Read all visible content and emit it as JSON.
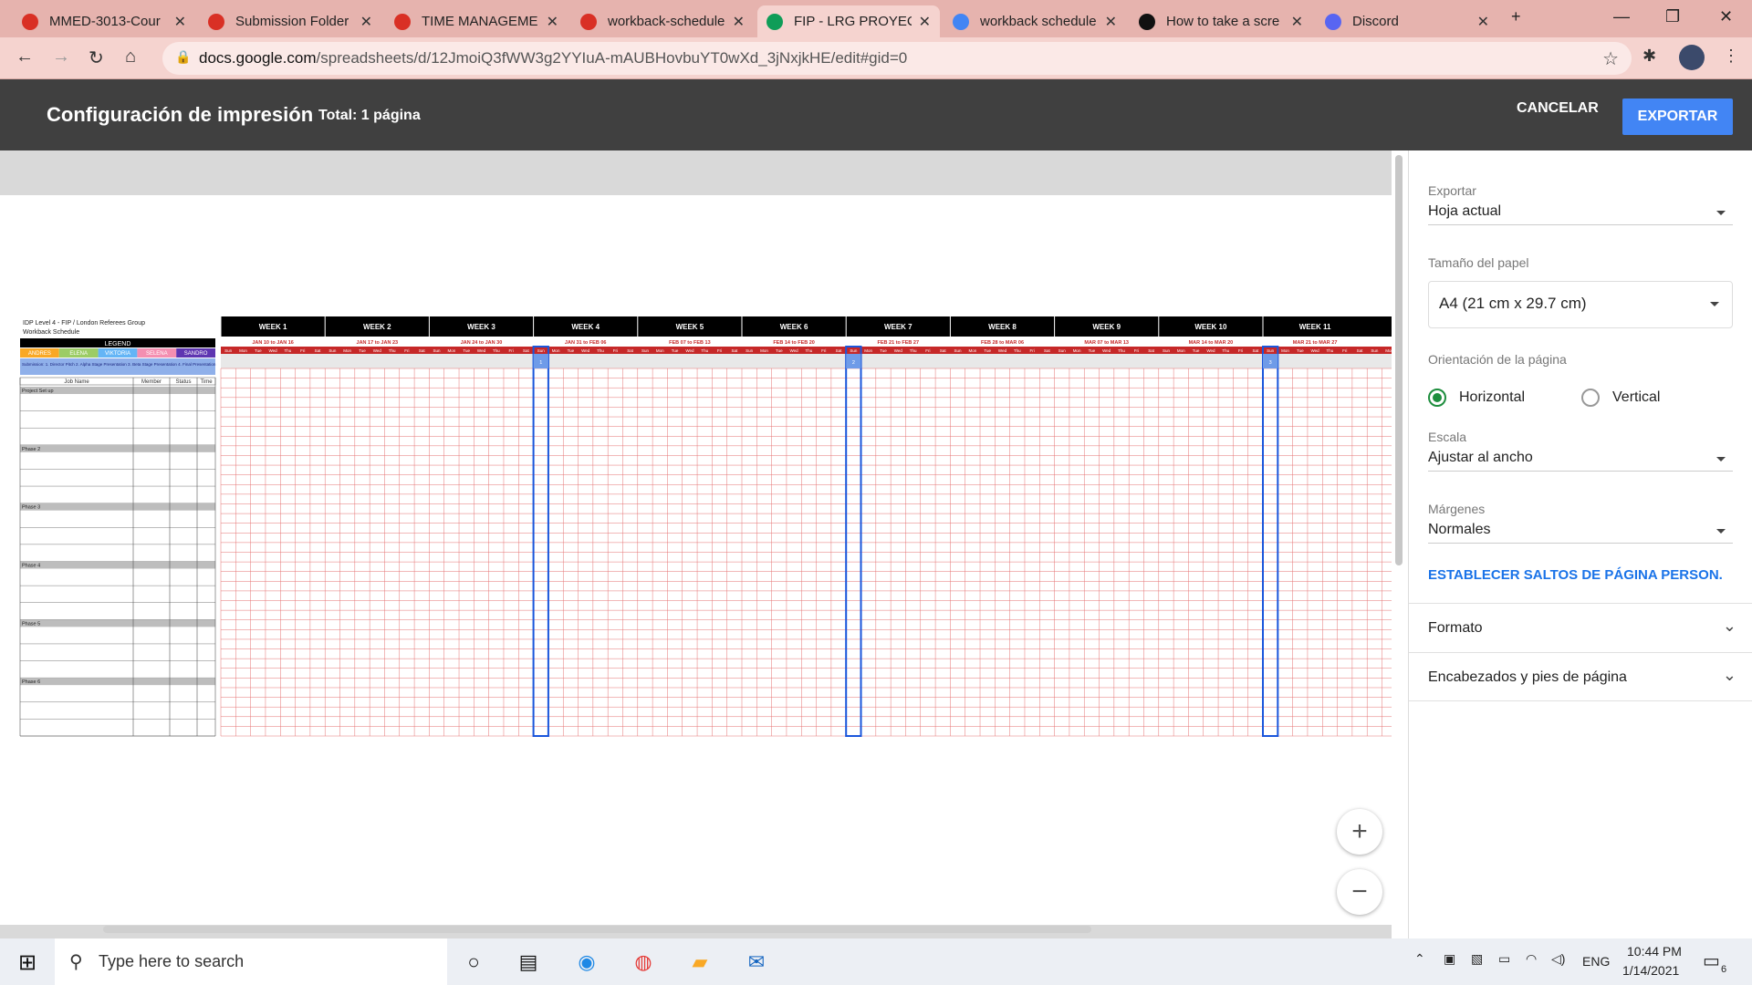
{
  "browser": {
    "tabs": [
      {
        "title": "MMED-3013-Cour",
        "favicon": "owl-icon",
        "color": "#d93025"
      },
      {
        "title": "Submission Folder",
        "favicon": "owl-icon",
        "color": "#d93025"
      },
      {
        "title": "TIME MANAGEME",
        "favicon": "owl-icon",
        "color": "#d93025"
      },
      {
        "title": "workback-schedule",
        "favicon": "owl-icon",
        "color": "#d93025"
      },
      {
        "title": "FIP - LRG PROYECT",
        "favicon": "sheets-icon",
        "color": "#0f9d58",
        "active": true
      },
      {
        "title": "workback schedule",
        "favicon": "google-icon",
        "color": "#4285f4"
      },
      {
        "title": "How to take a scre",
        "favicon": "g-icon",
        "color": "#111111"
      },
      {
        "title": "Discord",
        "favicon": "discord-icon",
        "color": "#5865f2"
      }
    ],
    "new_tab": "+",
    "url_host": "docs.google.com",
    "url_path": "/spreadsheets/d/12JmoiQ3fWW3g2YYIuA-mAUBHovbuYT0wXd_3jNxjkHE/edit#gid=0"
  },
  "header": {
    "title": "Configuración de impresión",
    "total": "Total: 1 página",
    "cancel_label": "CANCELAR",
    "export_label": "EXPORTAR",
    "accent": "#4285f4"
  },
  "sheet": {
    "title_line1": "IDP Level 4 - FIP / London Referees Group",
    "title_line2": "Workback Schedule",
    "legend_label": "LEGEND",
    "members": [
      {
        "name": "ANDRES",
        "color": "#f9a825"
      },
      {
        "name": "ELENA",
        "color": "#9ccc65"
      },
      {
        "name": "VIKTORIA",
        "color": "#64b5f6"
      },
      {
        "name": "SELENA",
        "color": "#f48fb1"
      },
      {
        "name": "SANDRO",
        "color": "#5e35b1"
      }
    ],
    "submission_note": "Submission: 1. Director Pitch 2. Alpha Stage Presentation 3. Beta Stage Presentation 4. Final Presentation",
    "columns": [
      "Job Name",
      "Member",
      "Status",
      "Time"
    ],
    "phases": [
      "Project Set up",
      "Phase 2",
      "Phase 3",
      "Phase 4",
      "Phase 5",
      "Phase 6"
    ],
    "weeks": [
      {
        "label": "WEEK 1",
        "range": "JAN 10 to JAN 16"
      },
      {
        "label": "WEEK 2",
        "range": "JAN 17 to JAN 23"
      },
      {
        "label": "WEEK 3",
        "range": "JAN 24 to JAN 30"
      },
      {
        "label": "WEEK 4",
        "range": "JAN 31 to FEB 06"
      },
      {
        "label": "WEEK 5",
        "range": "FEB 07 to FEB 13"
      },
      {
        "label": "WEEK 6",
        "range": "FEB 14 to FEB 20"
      },
      {
        "label": "WEEK 7",
        "range": "FEB 21 to FEB 27"
      },
      {
        "label": "WEEK 8",
        "range": "FEB 28 to MAR 06"
      },
      {
        "label": "WEEK 9",
        "range": "MAR 07 to MAR 13"
      },
      {
        "label": "WEEK 10",
        "range": "MAR 14 to MAR 20"
      },
      {
        "label": "WEEK 11",
        "range": "MAR 21 to MAR 27"
      }
    ],
    "day_labels": [
      "Sun",
      "Mon",
      "Tue",
      "Wed",
      "Thu",
      "Fri",
      "Sat"
    ],
    "milestones": [
      {
        "week_index": 3,
        "number": "1"
      },
      {
        "week_index": 6,
        "number": "2"
      },
      {
        "week_index": 10,
        "number": "3"
      }
    ],
    "day_header_color": "#c62828",
    "week_header_color": "#000000",
    "milestone_color": "#1a56db"
  },
  "settings": {
    "export_label": "Exportar",
    "export_value": "Hoja actual",
    "paper_label": "Tamaño del papel",
    "paper_value": "A4 (21 cm x 29.7 cm)",
    "orientation_label": "Orientación de la página",
    "orientation_options": [
      "Horizontal",
      "Vertical"
    ],
    "orientation_selected": "Horizontal",
    "scale_label": "Escala",
    "scale_value": "Ajustar al ancho",
    "margins_label": "Márgenes",
    "margins_value": "Normales",
    "page_breaks_link": "ESTABLECER SALTOS DE PÁGINA PERSON.",
    "format_label": "Formato",
    "headers_label": "Encabezados y pies de página"
  },
  "zoom": {
    "in": "+",
    "out": "−"
  },
  "taskbar": {
    "search_placeholder": "Type here to search",
    "language": "ENG",
    "time": "10:44 PM",
    "date": "1/14/2021",
    "notification_count": "6"
  }
}
